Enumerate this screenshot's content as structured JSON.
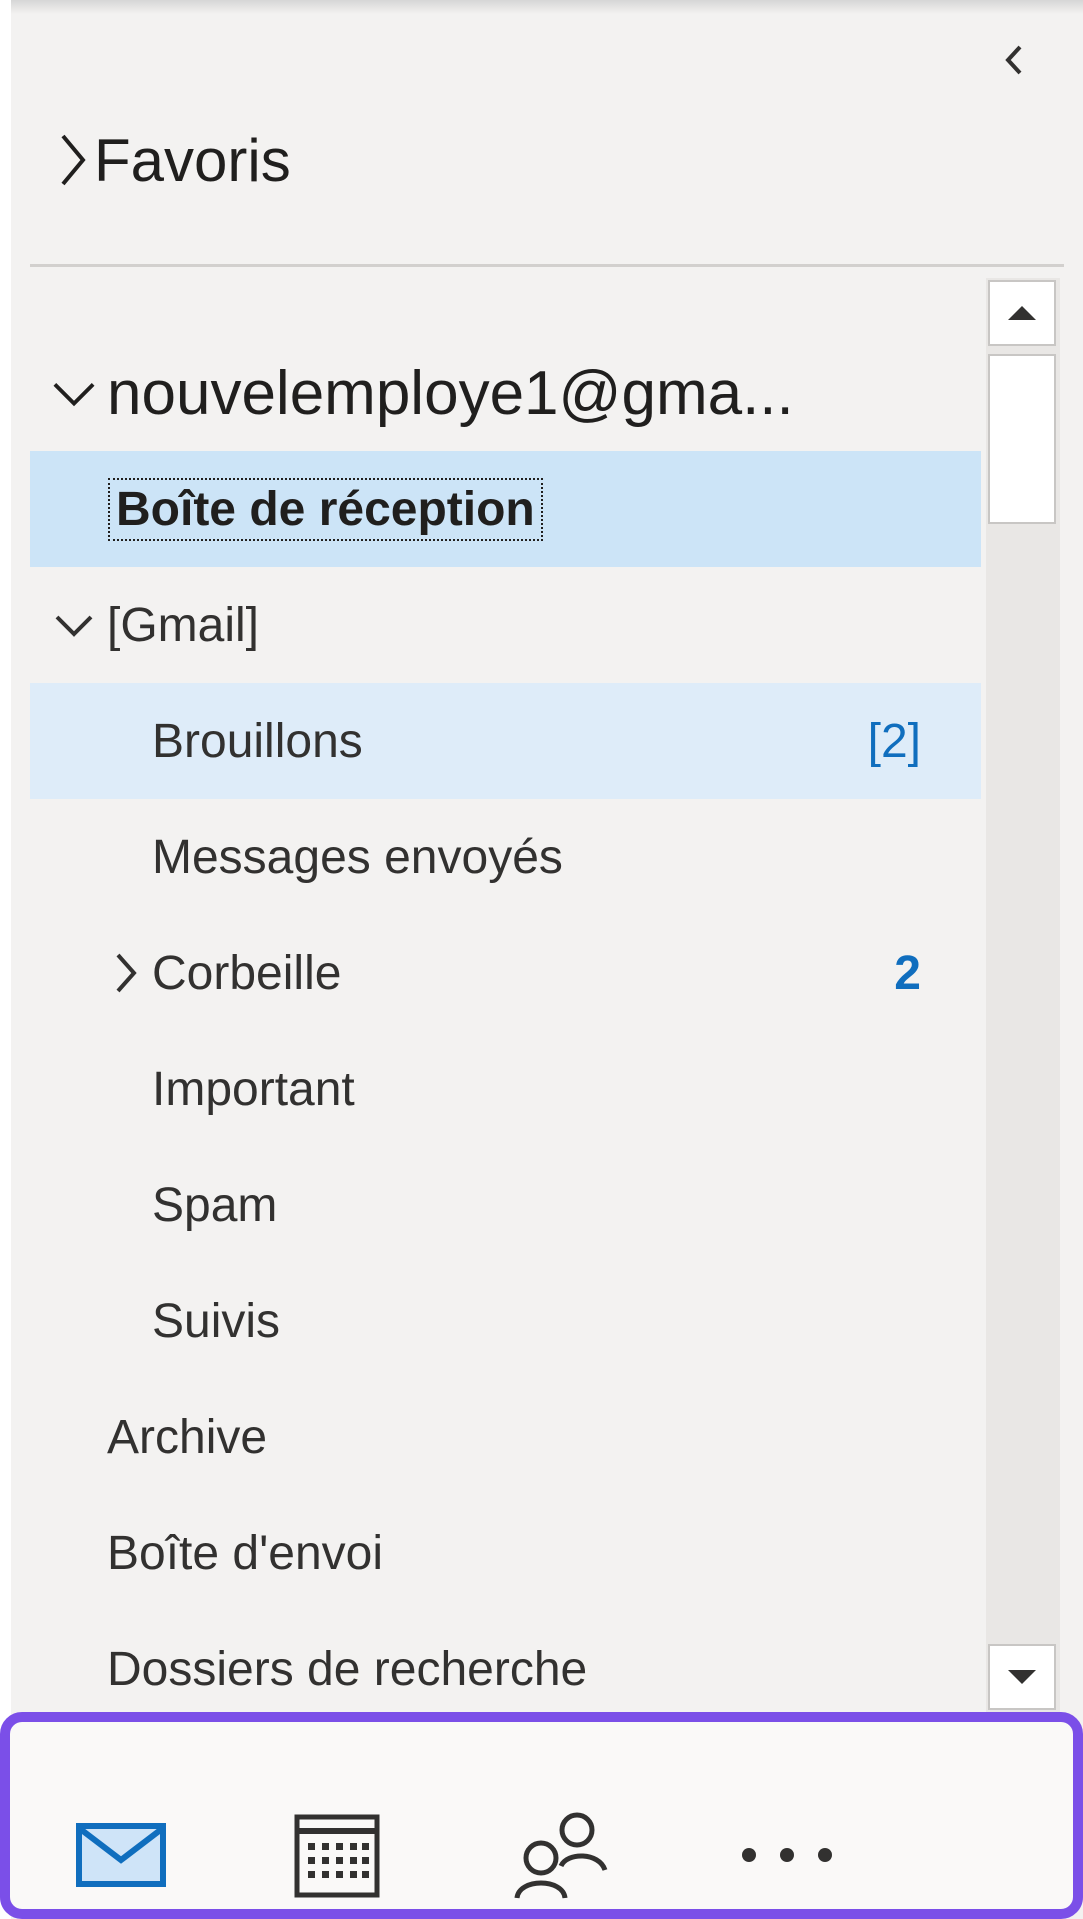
{
  "favorites": {
    "label": "Favoris"
  },
  "account": {
    "email": "nouvelemploye1@gma..."
  },
  "folders": {
    "inbox": "Boîte de réception",
    "gmail": "[Gmail]",
    "drafts": {
      "label": "Brouillons",
      "count": "[2]"
    },
    "sent": "Messages envoyés",
    "trash": {
      "label": "Corbeille",
      "count": "2"
    },
    "important": "Important",
    "spam": "Spam",
    "followups": "Suivis",
    "archive": "Archive",
    "outbox": "Boîte d'envoi",
    "search_folders": "Dossiers de recherche"
  },
  "bottom_nav": {
    "items": [
      "mail-icon",
      "calendar-icon",
      "people-icon",
      "more-icon"
    ],
    "active": "mail-icon"
  },
  "colors": {
    "accent": "#106ebe",
    "selection": "#cce4f7",
    "hover": "#deecf9",
    "highlight_border": "#7b4fe8"
  }
}
